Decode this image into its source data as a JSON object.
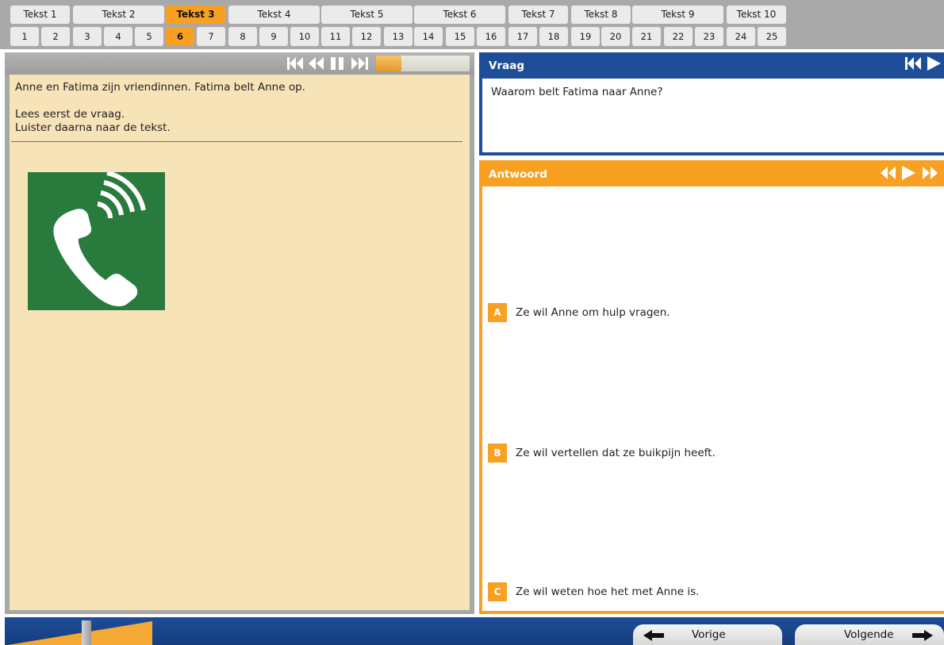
{
  "nav": {
    "texts": [
      "Tekst 1",
      "Tekst 2",
      "Tekst 3",
      "Tekst 4",
      "Tekst 5",
      "Tekst 6",
      "Tekst 7",
      "Tekst 8",
      "Tekst 9",
      "Tekst 10"
    ],
    "active_text": "Tekst 3",
    "questions": [
      "1",
      "2",
      "3",
      "4",
      "5",
      "6",
      "7",
      "8",
      "9",
      "10",
      "11",
      "12",
      "13",
      "14",
      "15",
      "16",
      "17",
      "18",
      "19",
      "20",
      "21",
      "22",
      "23",
      "24",
      "25"
    ],
    "active_question": "6"
  },
  "player": {
    "icons": [
      "skip-to-start-icon",
      "rewind-icon",
      "pause-icon",
      "skip-forward-icon"
    ],
    "progress": 0.27
  },
  "left": {
    "intro": "Anne en Fatima zijn vriendinnen. Fatima belt Anne op.",
    "instruction_1": "Lees eerst de vraag.",
    "instruction_2": "Luister daarna naar de tekst.",
    "image_icon": "phone-ringing-icon"
  },
  "question": {
    "title": "Vraag",
    "text": "Waarom belt Fatima naar Anne?"
  },
  "answer": {
    "title": "Antwoord",
    "options": [
      {
        "letter": "A",
        "text": "Ze wil Anne om hulp vragen."
      },
      {
        "letter": "B",
        "text": "Ze wil vertellen dat ze buikpijn heeft."
      },
      {
        "letter": "C",
        "text": "Ze wil weten hoe het met Anne is."
      }
    ]
  },
  "footer": {
    "prev_label": "Vorige",
    "next_label": "Volgende"
  },
  "colors": {
    "accent": "#f7a021",
    "question_blue": "#1f4e98",
    "text_panel": "#f7e3b8",
    "sign_green": "#297a3d"
  }
}
